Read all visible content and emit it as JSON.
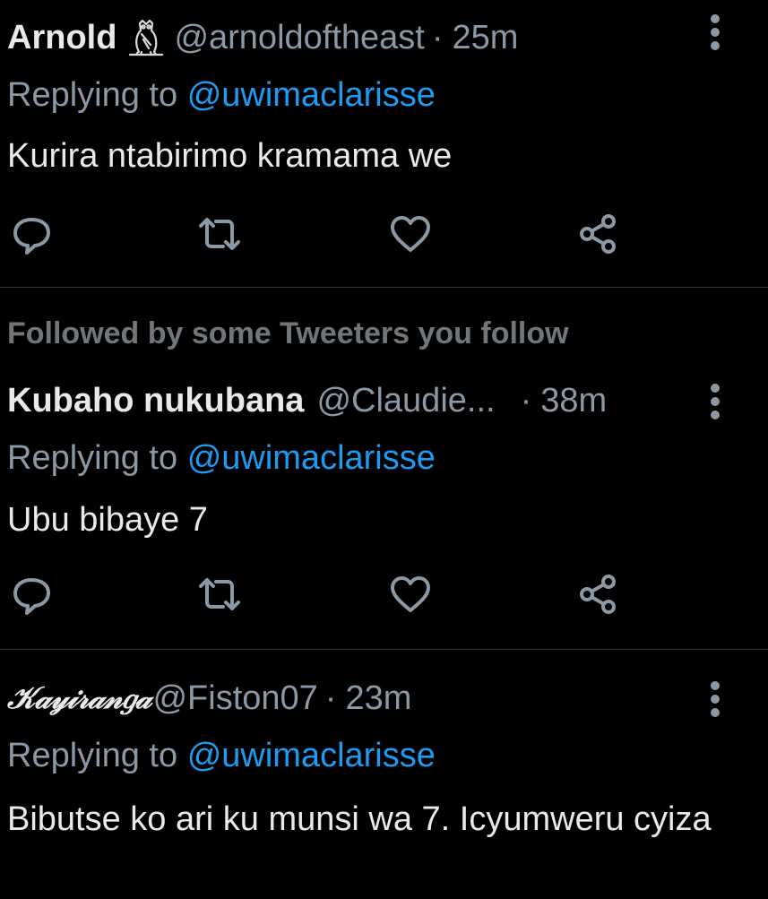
{
  "colors": {
    "background": "#000000",
    "text_primary": "#e7e9ea",
    "text_secondary": "#8b98a5",
    "mention": "#1d9bf0",
    "divider": "#2f3336"
  },
  "tweets": [
    {
      "display_name": "Arnold",
      "badge_icon": "owl-icon",
      "handle": "@arnoldoftheast",
      "separator": "·",
      "time": "25m",
      "replying_label": "Replying to",
      "replying_to": "@uwimaclarisse",
      "text": "Kurira ntabirimo kramama we"
    },
    {
      "social_context": "Followed by some Tweeters you follow",
      "display_name": "Kubaho nukubana",
      "handle": "@Claudie...",
      "separator": "·",
      "time": "38m",
      "replying_label": "Replying to",
      "replying_to": "@uwimaclarisse",
      "text": "Ubu bibaye 7"
    },
    {
      "display_name": "𝒦𝒶𝓎𝒾𝓇𝒶𝓃𝑔𝒶",
      "handle": "@Fiston07",
      "separator": "·",
      "time": "23m",
      "replying_label": "Replying to",
      "replying_to": "@uwimaclarisse",
      "text": "Bibutse ko ari ku munsi wa 7. Icyumweru cyiza"
    }
  ],
  "action_icons": [
    "reply-icon",
    "retweet-icon",
    "like-icon",
    "share-icon"
  ]
}
